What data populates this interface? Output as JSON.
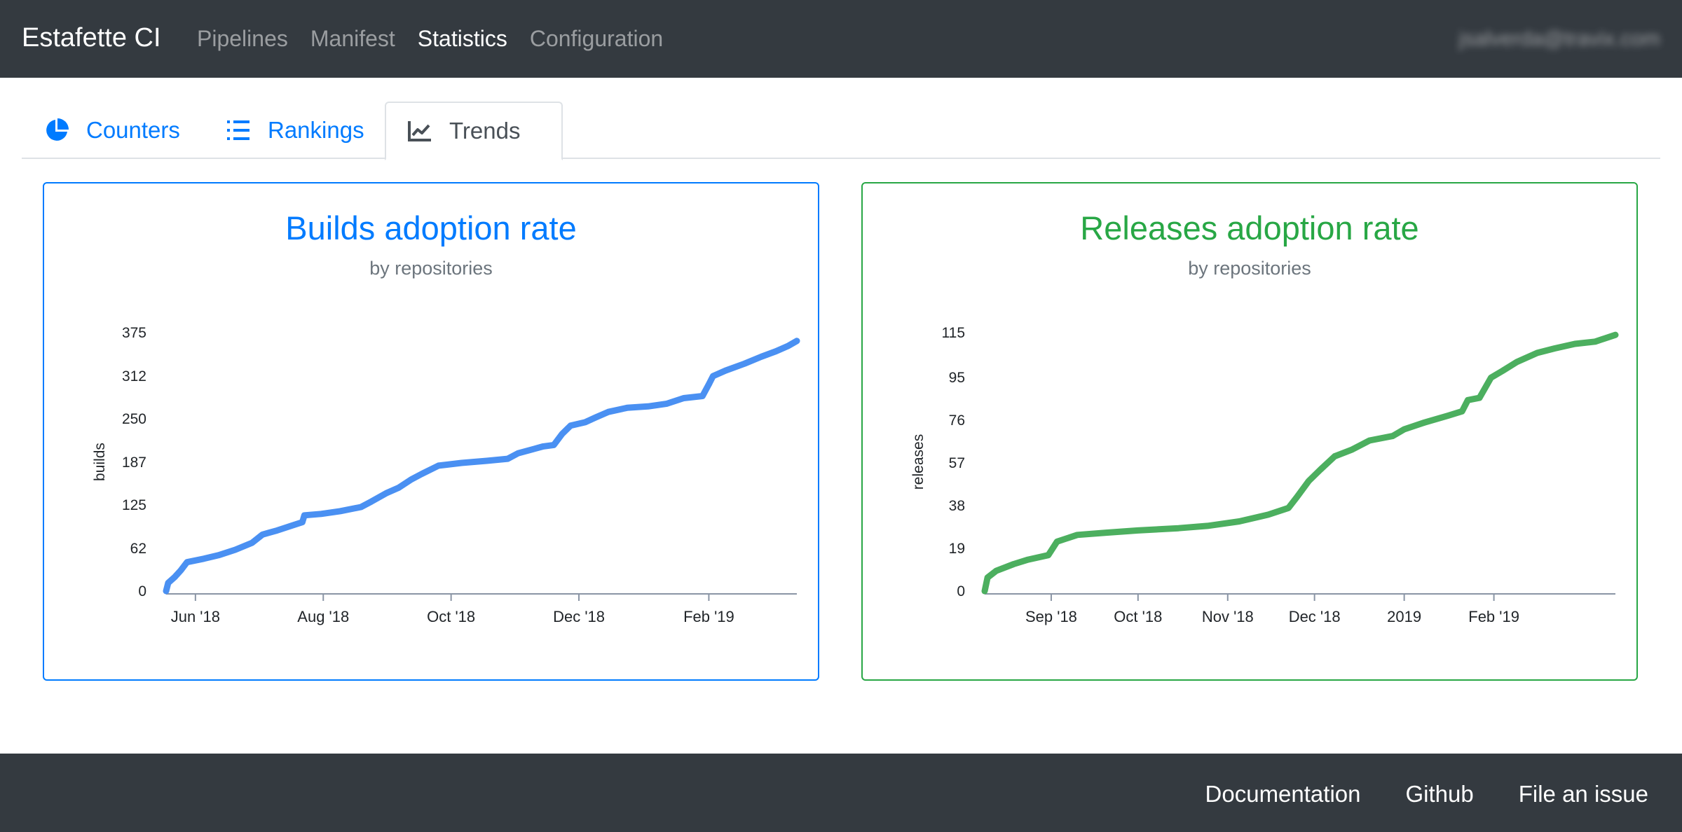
{
  "navbar": {
    "brand": "Estafette CI",
    "links": [
      "Pipelines",
      "Manifest",
      "Statistics",
      "Configuration"
    ],
    "active": "Statistics",
    "user": "jsalverda@travix.com"
  },
  "tabs": [
    {
      "label": "Counters",
      "icon": "pie-chart-icon"
    },
    {
      "label": "Rankings",
      "icon": "ordered-list-icon"
    },
    {
      "label": "Trends",
      "icon": "line-chart-icon",
      "active": true
    }
  ],
  "colors": {
    "navbar": "#343a40",
    "builds": "#007bff",
    "builds_line": "#4a90f2",
    "releases": "#28a745",
    "releases_line": "#4caf5f"
  },
  "footer": {
    "links": [
      "Documentation",
      "Github",
      "File an issue"
    ]
  },
  "chart_data": [
    {
      "type": "line",
      "title": "Builds adoption rate",
      "subtitle": "by repositories",
      "ylabel": "builds",
      "xlabel": "",
      "ylim": [
        0,
        375
      ],
      "yticks": [
        0,
        62,
        125,
        187,
        250,
        312,
        375
      ],
      "xticks": [
        {
          "date": "2018-06-01",
          "label": "Jun '18"
        },
        {
          "date": "2018-08-01",
          "label": "Aug '18"
        },
        {
          "date": "2018-10-01",
          "label": "Oct '18"
        },
        {
          "date": "2018-12-01",
          "label": "Dec '18"
        },
        {
          "date": "2019-02-01",
          "label": "Feb '19"
        }
      ],
      "xlim": [
        "2018-05-18",
        "2019-03-15"
      ],
      "series": [
        {
          "values": [
            [
              "2018-05-18",
              0
            ],
            [
              "2018-05-19",
              12
            ],
            [
              "2018-05-22",
              20
            ],
            [
              "2018-05-25",
              30
            ],
            [
              "2018-05-28",
              42
            ],
            [
              "2018-06-05",
              47
            ],
            [
              "2018-06-12",
              52
            ],
            [
              "2018-06-20",
              60
            ],
            [
              "2018-06-28",
              70
            ],
            [
              "2018-07-03",
              82
            ],
            [
              "2018-07-10",
              88
            ],
            [
              "2018-07-17",
              95
            ],
            [
              "2018-07-22",
              100
            ],
            [
              "2018-07-23",
              110
            ],
            [
              "2018-07-31",
              112
            ],
            [
              "2018-08-09",
              116
            ],
            [
              "2018-08-19",
              122
            ],
            [
              "2018-08-24",
              130
            ],
            [
              "2018-08-31",
              142
            ],
            [
              "2018-09-06",
              150
            ],
            [
              "2018-09-12",
              162
            ],
            [
              "2018-09-17",
              170
            ],
            [
              "2018-09-25",
              182
            ],
            [
              "2018-10-06",
              186
            ],
            [
              "2018-10-18",
              189
            ],
            [
              "2018-10-28",
              192
            ],
            [
              "2018-11-02",
              200
            ],
            [
              "2018-11-08",
              205
            ],
            [
              "2018-11-14",
              210
            ],
            [
              "2018-11-19",
              212
            ],
            [
              "2018-11-23",
              228
            ],
            [
              "2018-11-27",
              240
            ],
            [
              "2018-12-04",
              245
            ],
            [
              "2018-12-09",
              252
            ],
            [
              "2018-12-15",
              260
            ],
            [
              "2018-12-24",
              266
            ],
            [
              "2019-01-03",
              268
            ],
            [
              "2019-01-12",
              272
            ],
            [
              "2019-01-20",
              280
            ],
            [
              "2019-01-29",
              283
            ],
            [
              "2019-02-01",
              300
            ],
            [
              "2019-02-03",
              312
            ],
            [
              "2019-02-09",
              320
            ],
            [
              "2019-02-18",
              330
            ],
            [
              "2019-02-26",
              340
            ],
            [
              "2019-03-05",
              348
            ],
            [
              "2019-03-11",
              356
            ],
            [
              "2019-03-15",
              363
            ]
          ]
        }
      ]
    },
    {
      "type": "line",
      "title": "Releases adoption rate",
      "subtitle": "by repositories",
      "ylabel": "releases",
      "xlabel": "",
      "ylim": [
        0,
        115
      ],
      "yticks": [
        0,
        19,
        38,
        57,
        76,
        95,
        115
      ],
      "xticks": [
        {
          "date": "2018-09-01",
          "label": "Sep '18"
        },
        {
          "date": "2018-10-01",
          "label": "Oct '18"
        },
        {
          "date": "2018-11-01",
          "label": "Nov '18"
        },
        {
          "date": "2018-12-01",
          "label": "Dec '18"
        },
        {
          "date": "2019-01-01",
          "label": "2019"
        },
        {
          "date": "2019-02-01",
          "label": "Feb '19"
        }
      ],
      "xlim": [
        "2018-08-09",
        "2019-03-15"
      ],
      "series": [
        {
          "values": [
            [
              "2018-08-09",
              0
            ],
            [
              "2018-08-10",
              6
            ],
            [
              "2018-08-13",
              9
            ],
            [
              "2018-08-19",
              12
            ],
            [
              "2018-08-24",
              14
            ],
            [
              "2018-08-31",
              16
            ],
            [
              "2018-09-03",
              22
            ],
            [
              "2018-09-10",
              25
            ],
            [
              "2018-09-20",
              26
            ],
            [
              "2018-10-01",
              27
            ],
            [
              "2018-10-15",
              28
            ],
            [
              "2018-10-25",
              29
            ],
            [
              "2018-11-05",
              31
            ],
            [
              "2018-11-15",
              34
            ],
            [
              "2018-11-22",
              37
            ],
            [
              "2018-11-25",
              42
            ],
            [
              "2018-11-29",
              49
            ],
            [
              "2018-12-03",
              54
            ],
            [
              "2018-12-08",
              60
            ],
            [
              "2018-12-14",
              63
            ],
            [
              "2018-12-20",
              67
            ],
            [
              "2018-12-28",
              69
            ],
            [
              "2019-01-01",
              72
            ],
            [
              "2019-01-08",
              75
            ],
            [
              "2019-01-16",
              78
            ],
            [
              "2019-01-21",
              80
            ],
            [
              "2019-01-23",
              85
            ],
            [
              "2019-01-27",
              86
            ],
            [
              "2019-01-31",
              95
            ],
            [
              "2019-02-04",
              98
            ],
            [
              "2019-02-09",
              102
            ],
            [
              "2019-02-16",
              106
            ],
            [
              "2019-02-22",
              108
            ],
            [
              "2019-03-01",
              110
            ],
            [
              "2019-03-08",
              111
            ],
            [
              "2019-03-15",
              114
            ]
          ]
        }
      ]
    }
  ]
}
